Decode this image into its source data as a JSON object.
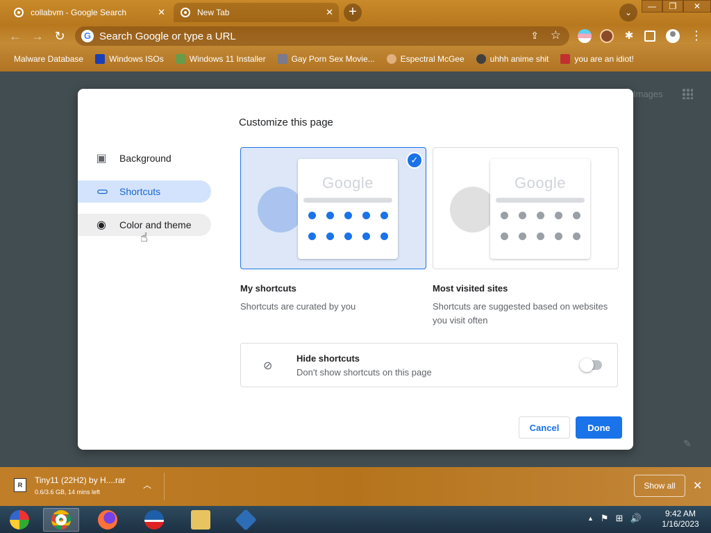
{
  "tabs": [
    {
      "title": "collabvm - Google Search",
      "close": "✕"
    },
    {
      "title": "New Tab",
      "close": "✕"
    }
  ],
  "newtab_symbol": "+",
  "tabsearch_symbol": "⌄",
  "window_controls": {
    "minimize": "—",
    "maximize": "❐",
    "close": "✕"
  },
  "nav": {
    "back": "←",
    "forward": "→",
    "reload": "↻"
  },
  "omnibox": {
    "g_letter": "G",
    "placeholder": "Search Google or type a URL",
    "share": "⇪",
    "star": "☆"
  },
  "extensions": {
    "puzzle": "✱",
    "menu": "⋮"
  },
  "bookmarks": [
    {
      "label": "Malware Database",
      "color": ""
    },
    {
      "label": "Windows ISOs",
      "color": "#1a3fb5"
    },
    {
      "label": "Windows 11 Installer",
      "color": "#6a9a4a"
    },
    {
      "label": "Gay Porn Sex Movie...",
      "color": "#7a7a8a"
    },
    {
      "label": "Espectral McGee",
      "color": "#e0b080"
    },
    {
      "label": "uhhh anime shit",
      "color": "#404040"
    },
    {
      "label": "you are an idiot!",
      "color": "#c03030"
    }
  ],
  "page_bg": {
    "images_link": "Images",
    "edit_symbol": "✎"
  },
  "dialog": {
    "title": "Customize this page",
    "sidebar": [
      {
        "label": "Background",
        "icon": "▣",
        "state": "normal"
      },
      {
        "label": "Shortcuts",
        "icon": "⊂⊃",
        "state": "selected"
      },
      {
        "label": "Color and theme",
        "icon": "◉",
        "state": "hover"
      }
    ],
    "cursor_symbol": "☝",
    "options": [
      {
        "title": "My shortcuts",
        "description": "Shortcuts are curated by you",
        "mock_logo": "Google",
        "selected": true,
        "check": "✓"
      },
      {
        "title": "Most visited sites",
        "description": "Shortcuts are suggested based on websites you visit often",
        "mock_logo": "Google",
        "selected": false
      }
    ],
    "hide_shortcuts": {
      "icon": "⊘",
      "title": "Hide shortcuts",
      "description": "Don't show shortcuts on this page",
      "enabled": false
    },
    "buttons": {
      "cancel": "Cancel",
      "done": "Done"
    },
    "colors": {
      "accent": "#1a73e8",
      "selected_bg": "#dde7f7",
      "dot_active": "#1a73e8",
      "dot_inactive": "#9aa0a6"
    }
  },
  "download": {
    "icon_letter": "R",
    "filename": "Tiny11 (22H2) by H....rar",
    "status": "0.6/3.6 GB, 14 mins left",
    "chevron": "︿",
    "show_all": "Show all",
    "close": "✕"
  },
  "taskbar": {
    "tray": {
      "chevron": "▲",
      "flag": "⚑",
      "network": "⊞",
      "volume": "🔊"
    },
    "time": "9:42 AM",
    "date": "1/16/2023"
  }
}
